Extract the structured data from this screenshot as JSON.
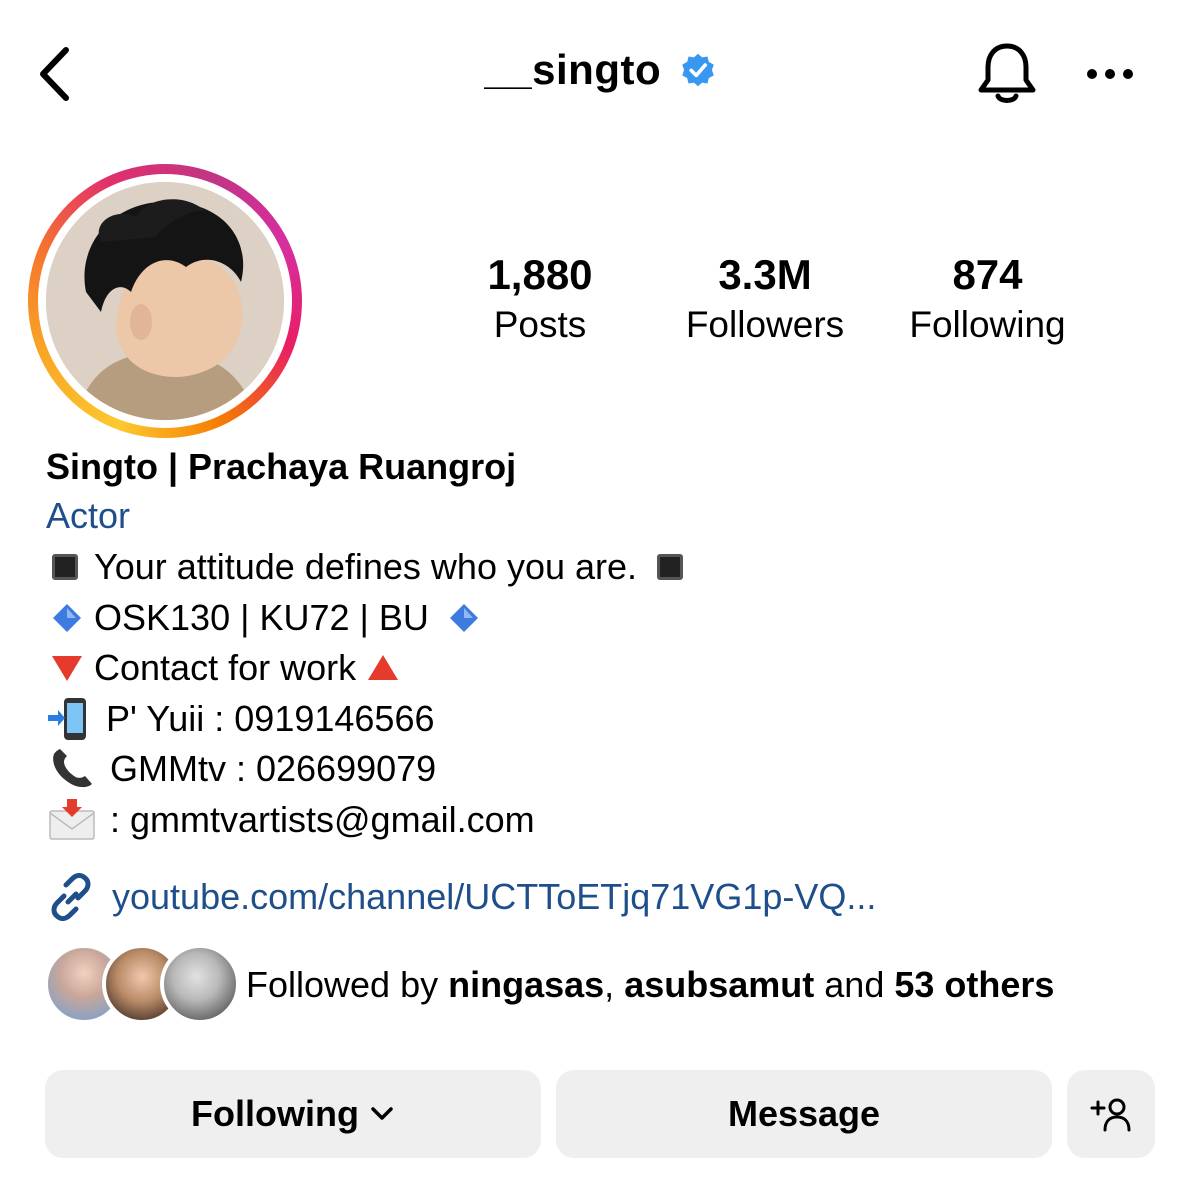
{
  "header": {
    "title": "__singto",
    "verified": true
  },
  "stats": [
    {
      "value": "1,880",
      "label": "Posts"
    },
    {
      "value": "3.3M",
      "label": "Followers"
    },
    {
      "value": "874",
      "label": "Following"
    }
  ],
  "bio": {
    "name": "Singto | Prachaya Ruangroj",
    "category": "Actor",
    "line1": "Your attitude defines who you are.",
    "line2": "OSK130 | KU72 | BU",
    "line3": "Contact for work",
    "line4": "P' Yuii : 0919146566",
    "line5": "GMMtv : 026699079",
    "line6": ": gmmtvartists@gmail.com",
    "link": "youtube.com/channel/UCTToETjq71VG1p-VQ..."
  },
  "followed_by": {
    "prefix": "Followed by",
    "user1": "ningasas",
    "sep": ",",
    "user2": "asubsamut",
    "and": "and",
    "others": "53 others"
  },
  "actions": {
    "following": "Following",
    "message": "Message"
  },
  "colors": {
    "verified_blue": "#3897f0",
    "link_blue": "#1e4f8a",
    "button_bg": "#efefef"
  },
  "icons": [
    "back-icon",
    "verified-badge-icon",
    "bell-icon",
    "more-icon",
    "link-icon",
    "chevron-down-icon",
    "add-user-icon"
  ]
}
